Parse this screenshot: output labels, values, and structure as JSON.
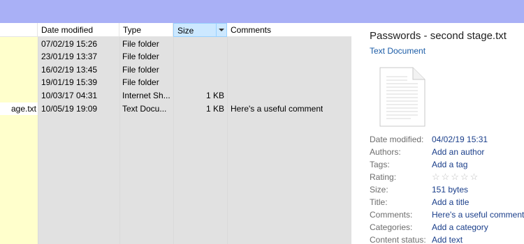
{
  "header": {
    "columns": [
      "Date modified",
      "Type",
      "Size",
      "Comments"
    ]
  },
  "rows": [
    {
      "name": "",
      "date": "07/02/19 15:26",
      "type": "File folder",
      "size": "",
      "comment": ""
    },
    {
      "name": "",
      "date": "23/01/19 13:37",
      "type": "File folder",
      "size": "",
      "comment": ""
    },
    {
      "name": "",
      "date": "16/02/19 13:45",
      "type": "File folder",
      "size": "",
      "comment": ""
    },
    {
      "name": "",
      "date": "19/01/19 15:39",
      "type": "File folder",
      "size": "",
      "comment": ""
    },
    {
      "name": "",
      "date": "10/03/17 04:31",
      "type": "Internet Sh...",
      "size": "1 KB",
      "comment": ""
    },
    {
      "name": "age.txt",
      "date": "10/05/19 19:09",
      "type": "Text Docu...",
      "size": "1 KB",
      "comment": "Here's a useful comment"
    }
  ],
  "details": {
    "title": "Passwords - second stage.txt",
    "subtitle": "Text Document",
    "icon": "text-document-icon",
    "properties": [
      {
        "key": "Date modified:",
        "value": "04/02/19 15:31"
      },
      {
        "key": "Authors:",
        "value": "Add an author"
      },
      {
        "key": "Tags:",
        "value": "Add a tag"
      },
      {
        "key": "Rating:",
        "value": "☆☆☆☆☆"
      },
      {
        "key": "Size:",
        "value": "151 bytes"
      },
      {
        "key": "Title:",
        "value": "Add a title"
      },
      {
        "key": "Comments:",
        "value": "Here's a useful comment"
      },
      {
        "key": "Categories:",
        "value": "Add a category"
      },
      {
        "key": "Content status:",
        "value": "Add text"
      }
    ]
  },
  "colors": {
    "titlebar": "#a9b0f6",
    "list_background": "#e1e1e1",
    "name_column": "#ffffcc",
    "link": "#1a3e8a"
  }
}
